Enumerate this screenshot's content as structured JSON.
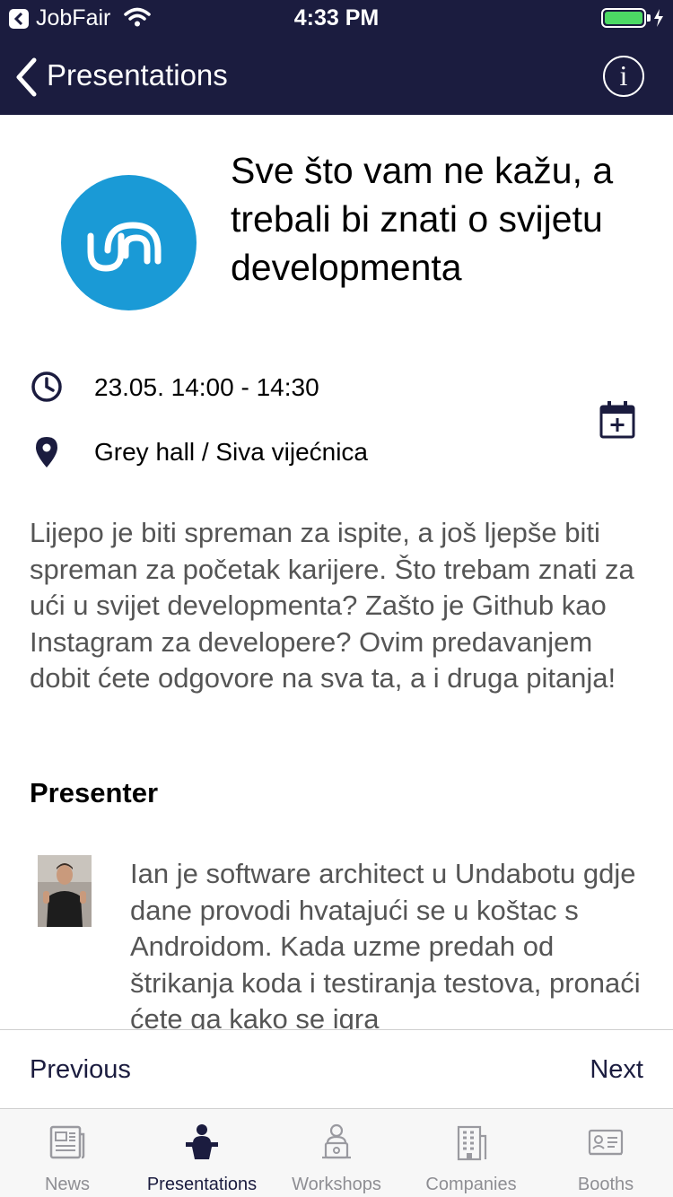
{
  "status_bar": {
    "carrier": "JobFair",
    "time": "4:33 PM",
    "battery_level": 1.0,
    "battery_color": "#4cd964"
  },
  "nav": {
    "back_label": "Presentations",
    "info_icon": "info-icon",
    "bar_color": "#1b1c3f"
  },
  "presentation": {
    "title": "Sve što vam ne kažu, a trebali bi znati o svijetu developmenta",
    "logo_color": "#1a9ad6",
    "datetime": "23.05. 14:00 - 14:30",
    "location": "Grey hall / Siva vijećnica",
    "description": "Lijepo je biti spreman za ispite, a još ljepše biti spreman za početak karijere. Što trebam znati za ući u svijet developmenta? Zašto je Github kao Instagram za developere? Ovim predavanjem dobit ćete odgovore na sva ta, a i druga pitanja!"
  },
  "presenter": {
    "heading": "Presenter",
    "bio": "Ian je software architect u Undabotu gdje dane provodi hvatajući se u koštac s Androidom. Kada uzme predah od štrikanja koda i testiranja testova, pronaći ćete ga kako se igra"
  },
  "pager": {
    "previous": "Previous",
    "next": "Next"
  },
  "tabs": [
    {
      "label": "News",
      "icon": "newspaper-icon",
      "active": false
    },
    {
      "label": "Presentations",
      "icon": "podium-icon",
      "active": true
    },
    {
      "label": "Workshops",
      "icon": "workshop-icon",
      "active": false
    },
    {
      "label": "Companies",
      "icon": "building-icon",
      "active": false
    },
    {
      "label": "Booths",
      "icon": "booth-icon",
      "active": false
    }
  ]
}
